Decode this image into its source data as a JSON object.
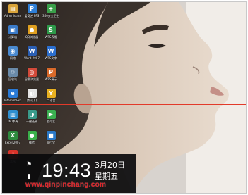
{
  "desktop": {
    "icons": [
      {
        "label": "Administrator",
        "glyph": "▤",
        "color": "#d9a43a"
      },
      {
        "label": "爱奇艺 PPS",
        "glyph": "P",
        "color": "#2f7fd6"
      },
      {
        "label": "360安全卫士",
        "glyph": "+",
        "color": "#3aa04a"
      },
      {
        "label": "计算机",
        "glyph": "▣",
        "color": "#3b7bc8"
      },
      {
        "label": "QQ浏览器",
        "glyph": "●",
        "color": "#e0a020"
      },
      {
        "label": "WPS表格",
        "glyph": "S",
        "color": "#2e9a4a"
      },
      {
        "label": "网络",
        "glyph": "◉",
        "color": "#4a8ad0"
      },
      {
        "label": "Word 2007",
        "glyph": "W",
        "color": "#2b5fb4"
      },
      {
        "label": "WPS文字",
        "glyph": "W",
        "color": "#2b6fd0"
      },
      {
        "label": "回收站",
        "glyph": "♲",
        "color": "#6a8aa8"
      },
      {
        "label": "谷歌浏览器",
        "glyph": "◎",
        "color": "#d24a3a"
      },
      {
        "label": "WPS演示",
        "glyph": "P",
        "color": "#d96a2a"
      },
      {
        "label": "Internet Explorer",
        "glyph": "e",
        "color": "#2a7ad6"
      },
      {
        "label": "腾讯QQ",
        "glyph": "◐",
        "color": "#e5e5e5"
      },
      {
        "label": "YY语音",
        "glyph": "Y",
        "color": "#e8b020"
      },
      {
        "label": "360杀毒",
        "glyph": "▥",
        "color": "#2f8fd0"
      },
      {
        "label": "一键还原",
        "glyph": "◑",
        "color": "#3a9a8a"
      },
      {
        "label": "爱奇艺",
        "glyph": "▶",
        "color": "#3bb050"
      },
      {
        "label": "Excel 2007",
        "glyph": "X",
        "color": "#2e8a3e"
      },
      {
        "label": "微信",
        "glyph": "●",
        "color": "#3ab04a"
      },
      {
        "label": "支付宝",
        "glyph": "■",
        "color": "#2a78c8"
      },
      {
        "label": "音乐",
        "glyph": "♪",
        "color": "#d9332a"
      }
    ]
  },
  "clock": {
    "time": "19:43",
    "date": "3月20日",
    "weekday": "星期五",
    "icons": [
      "flag-icon",
      "battery-icon"
    ]
  },
  "watermark": "www.qinpinchang.com",
  "colors": {
    "red_line": "#e23a2a",
    "watermark": "#e0252a",
    "clock_panel": "#0a0a0c"
  }
}
